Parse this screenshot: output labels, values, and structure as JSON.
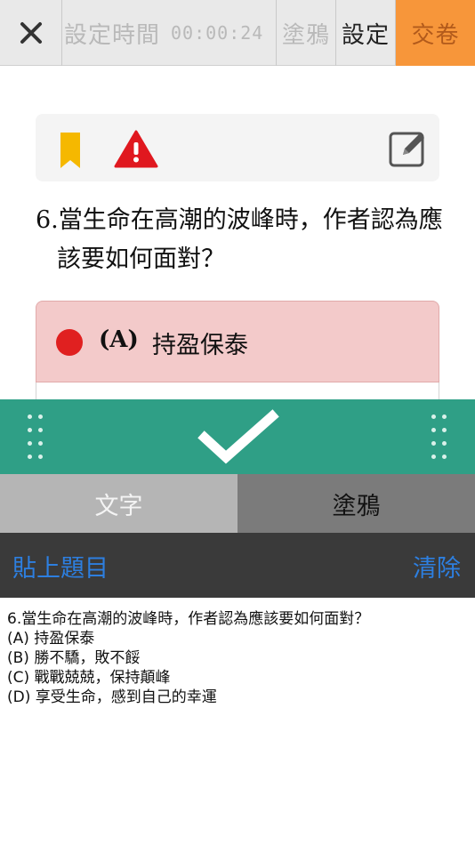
{
  "toolbar": {
    "close_symbol": "✕",
    "timer_label": "設定時間",
    "timer_value": "00:00:24",
    "doodle_label": "塗鴉",
    "settings_label": "設定",
    "submit_label": "交卷",
    "submit_color": "#f7963a"
  },
  "question_card": {
    "icons": [
      "bookmark-icon",
      "warning-icon",
      "edit-icon"
    ],
    "question_text": "6.當生命在高潮的波峰時，作者認為應該要如何面對？",
    "selected_option": {
      "letter": "(A)",
      "text": "持盈保泰",
      "highlight_color": "#f3caca",
      "marker_color": "#e02020"
    }
  },
  "confirm_bar": {
    "color": "#2f9f86",
    "icon": "checkmark-icon"
  },
  "mode_tabs": [
    {
      "label": "文字",
      "active": false
    },
    {
      "label": "塗鴉",
      "active": true
    }
  ],
  "actions": {
    "paste_label": "貼上題目",
    "clear_label": "清除",
    "link_color": "#2d7fe0"
  },
  "text_content": {
    "lines": [
      "6.當生命在高潮的波峰時，作者認為應該要如何面對？",
      "(A) 持盈保泰",
      "(B) 勝不驕，敗不餒",
      "(C) 戰戰兢兢，保持顛峰",
      "(D) 享受生命，感到自己的幸運"
    ]
  }
}
